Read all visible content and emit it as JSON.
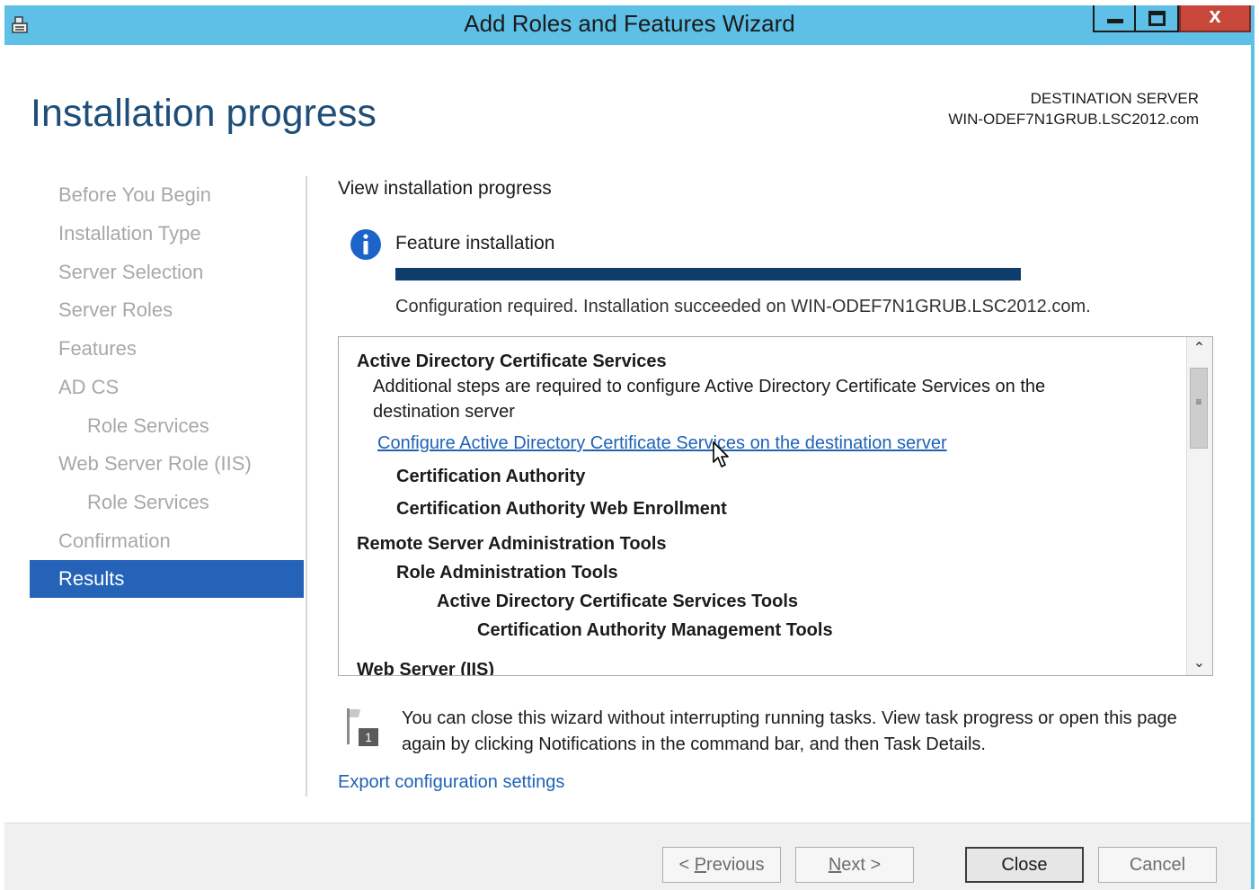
{
  "window": {
    "title": "Add Roles and Features Wizard",
    "close_glyph": "x"
  },
  "header": {
    "page_title": "Installation progress",
    "destination_label": "DESTINATION SERVER",
    "destination_server": "WIN-ODEF7N1GRUB.LSC2012.com"
  },
  "sidebar": {
    "items": [
      {
        "label": "Before You Begin"
      },
      {
        "label": "Installation Type"
      },
      {
        "label": "Server Selection"
      },
      {
        "label": "Server Roles"
      },
      {
        "label": "Features"
      },
      {
        "label": "AD CS"
      },
      {
        "label": "Role Services"
      },
      {
        "label": "Web Server Role (IIS)"
      },
      {
        "label": "Role Services"
      },
      {
        "label": "Confirmation"
      },
      {
        "label": "Results"
      }
    ],
    "active_item": "Results"
  },
  "main": {
    "view_label": "View installation progress",
    "feature_label": "Feature installation",
    "progress_fraction": 1.0,
    "status_text": "Configuration required. Installation succeeded on WIN-ODEF7N1GRUB.LSC2012.com.",
    "results": {
      "adcs_title": "Active Directory Certificate Services",
      "adcs_desc_1": "Additional steps are required to configure Active Directory Certificate Services on the",
      "adcs_desc_2": "destination server",
      "adcs_link": "Configure Active Directory Certificate Services on the destination server",
      "ca": "Certification Authority",
      "ca_web": "Certification Authority Web Enrollment",
      "rsat": "Remote Server Administration Tools",
      "role_admin": "Role Administration Tools",
      "adcs_tools": "Active Directory Certificate Services Tools",
      "ca_mgmt": "Certification Authority Management Tools",
      "web_server": "Web Server (IIS)"
    },
    "note_text": "You can close this wizard without interrupting running tasks. View task progress or open this page again by clicking Notifications in the command bar, and then Task Details.",
    "export_link": "Export configuration settings"
  },
  "footer": {
    "previous_prefix": "< ",
    "previous_accel": "P",
    "previous_rest": "revious",
    "next_accel": "N",
    "next_rest": "ext >",
    "close_label": "Close",
    "cancel_label": "Cancel"
  },
  "colors": {
    "titlebar": "#5ec0e6",
    "active_sidebar": "#2463b7",
    "progress": "#0f3d6b",
    "link": "#1f62b5"
  }
}
